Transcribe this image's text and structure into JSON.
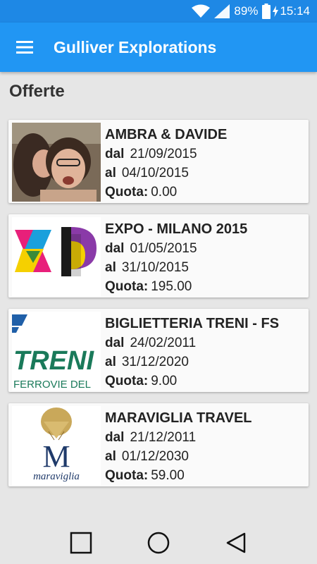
{
  "status_bar": {
    "battery_percent": "89%",
    "time": "15:14",
    "icons": [
      "wifi-icon",
      "signal-icon",
      "battery-icon",
      "charging-icon"
    ]
  },
  "app_bar": {
    "title": "Gulliver Explorations",
    "menu_icon": "hamburger-menu-icon",
    "color": "#2196f3",
    "status_color": "#1e88e5"
  },
  "section_title": "Offerte",
  "labels": {
    "from": "dal",
    "to": "al",
    "price": "Quota:"
  },
  "offers": [
    {
      "name": "AMBRA & DAVIDE",
      "from": "21/09/2015",
      "to": "04/10/2015",
      "price": "0.00",
      "image": "couple-photo"
    },
    {
      "name": "EXPO - MILANO 2015",
      "from": "01/05/2015",
      "to": "31/10/2015",
      "price": "195.00",
      "image": "expo-logo"
    },
    {
      "name": "BIGLIETTERIA TRENI - FS",
      "from": "24/02/2011",
      "to": "31/12/2020",
      "price": "9.00",
      "image": "treni-logo",
      "logo_text": "TRENI",
      "logo_subtext": "FERROVIE DEL"
    },
    {
      "name": "MARAVIGLIA TRAVEL",
      "from": "21/12/2011",
      "to": "01/12/2030",
      "price": "59.00",
      "image": "maraviglia-logo",
      "logo_text": "M",
      "logo_subtext": "maraviglia"
    }
  ],
  "nav_bar": [
    "recent-apps-icon",
    "home-icon",
    "back-icon"
  ]
}
